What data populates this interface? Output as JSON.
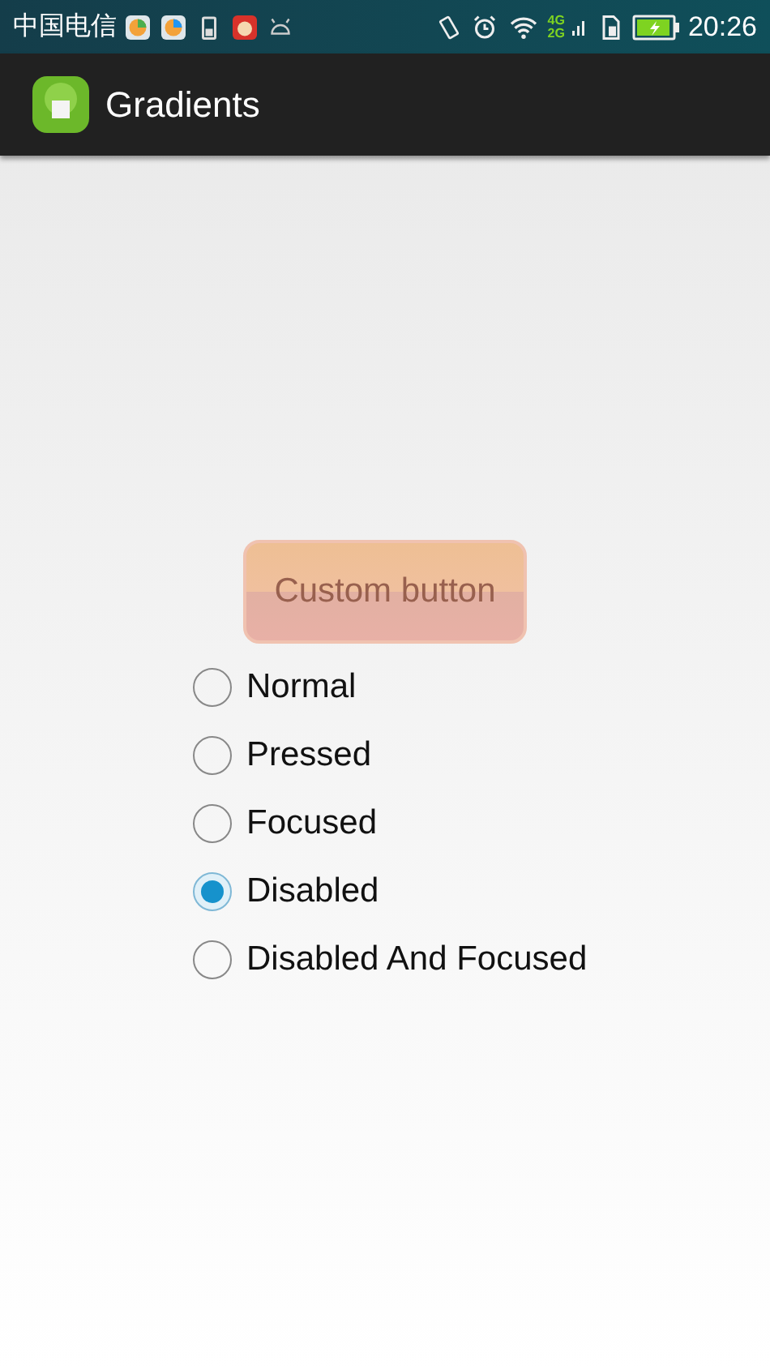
{
  "status_bar": {
    "carrier": "中国电信",
    "network": [
      "4G",
      "2G"
    ],
    "time": "20:26"
  },
  "app_bar": {
    "title": "Gradients"
  },
  "custom_button": {
    "label": "Custom button",
    "disabled": true
  },
  "options": [
    {
      "label": "Normal",
      "selected": false
    },
    {
      "label": "Pressed",
      "selected": false
    },
    {
      "label": "Focused",
      "selected": false
    },
    {
      "label": "Disabled",
      "selected": true
    },
    {
      "label": "Disabled And Focused",
      "selected": false
    }
  ]
}
